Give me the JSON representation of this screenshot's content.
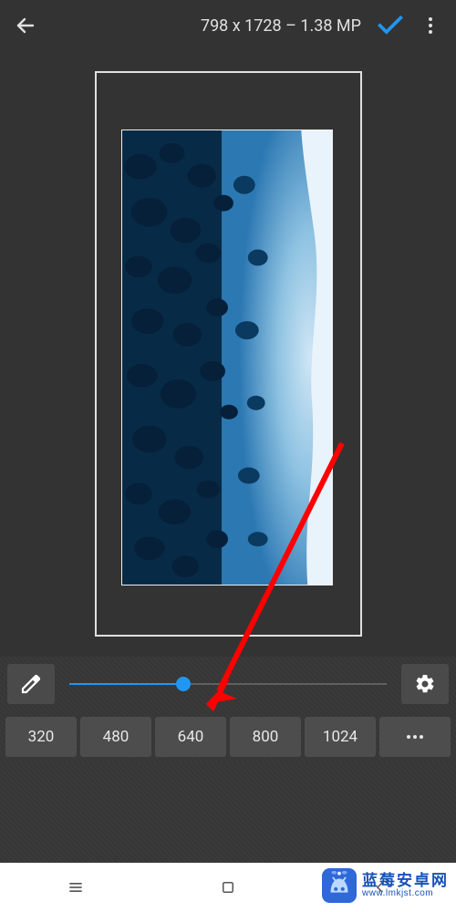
{
  "topbar": {
    "title": "798 x 1728 – 1.38 MP"
  },
  "slider": {
    "percent": 36
  },
  "presets": [
    "320",
    "480",
    "640",
    "800",
    "1024"
  ],
  "watermark": {
    "title": "蓝莓安卓网",
    "url": "www.lmkjst.com"
  },
  "colors": {
    "accent": "#2196f3",
    "arrow": "#ff0000"
  }
}
